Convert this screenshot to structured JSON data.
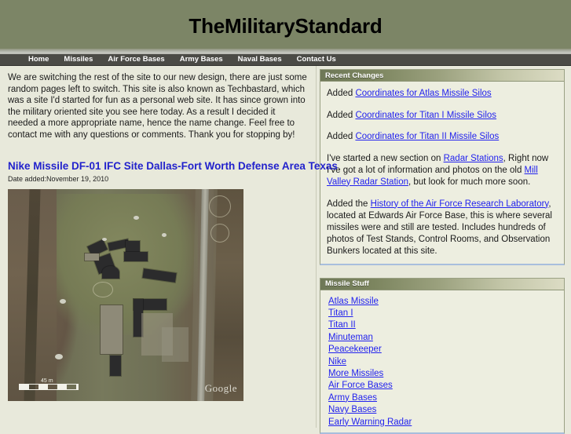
{
  "header": {
    "site_title": "TheMilitaryStandard"
  },
  "nav": {
    "items": [
      {
        "label": "Home"
      },
      {
        "label": "Missiles"
      },
      {
        "label": "Air Force Bases"
      },
      {
        "label": "Army Bases"
      },
      {
        "label": "Naval Bases"
      },
      {
        "label": "Contact Us"
      }
    ]
  },
  "main": {
    "intro": "We are switching the rest of the site to our new design, there are just some random pages left to switch. This site is also known as Techbastard, which was a site I'd started for fun as a personal web site. It has since grown into the military oriented site you see here today. As a result I decided it needed a more appropriate name, hence the name change. Feel free to contact me with any questions or comments. Thank you for stopping by!",
    "article_title": "Nike Missile DF-01 IFC Site Dallas-Fort Worth Defense Area Texas",
    "article_date": "Date added:November 19, 2010",
    "photo": {
      "scale_label": "45 m",
      "watermark": "Google"
    }
  },
  "sidebar": {
    "recent_changes": {
      "title": "Recent Changes",
      "added_label": "Added ",
      "items": [
        {
          "prefix": "Added ",
          "link": "Coordinates for Atlas Missile Silos"
        },
        {
          "prefix": "Added ",
          "link": "Coordinates for Titan I Missile Silos"
        },
        {
          "prefix": "Added ",
          "link": "Coordinates for Titan II Missile Silos"
        }
      ],
      "radar_para": {
        "a": "I've started a new section on ",
        "link1": "Radar Stations",
        "b": ", Right now I've got a lot of information and photos on the old ",
        "link2": "Mill Valley Radar Station",
        "c": ", but look for much more soon."
      },
      "afrl_para": {
        "a": "Added the ",
        "link1": "History of the Air Force Research Laboratory",
        "b": ", located at Edwards Air Force Base, this is where several missiles were and still are tested. Includes hundreds of photos of Test Stands, Control Rooms, and Observation Bunkers located at this site."
      }
    },
    "missile_stuff": {
      "title": "Missile Stuff",
      "links": [
        {
          "label": "Atlas Missile"
        },
        {
          "label": "Titan I"
        },
        {
          "label": "Titan II"
        },
        {
          "label": "Minuteman"
        },
        {
          "label": "Peacekeeper"
        },
        {
          "label": "Nike"
        },
        {
          "label": "More Missiles"
        },
        {
          "label": "Air Force Bases"
        },
        {
          "label": "Army Bases"
        },
        {
          "label": "Navy Bases"
        },
        {
          "label": "Early Warning Radar"
        }
      ]
    }
  },
  "colors": {
    "banner_green": "#7c8566",
    "page_bg": "#e8e9db",
    "nav_bar": "#4b4b46",
    "link_blue": "#2222ee",
    "panel_border": "#9aa184",
    "panel_underline": "#a8bedd"
  }
}
